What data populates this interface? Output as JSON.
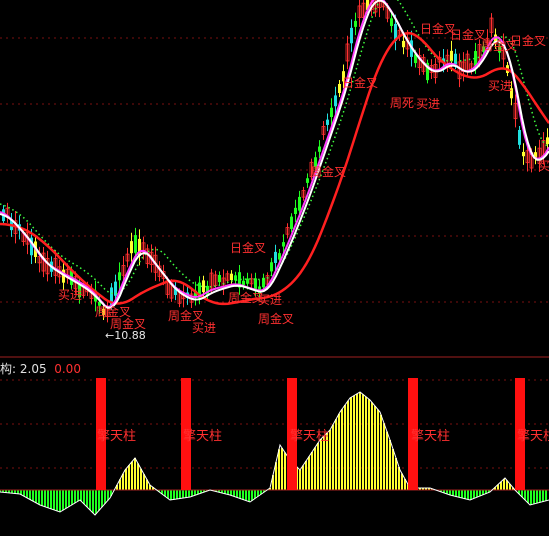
{
  "colors": {
    "background": "#000000",
    "price_up": "#ff3030",
    "price_down": "#20e0e0",
    "volume_up": "#ffff30",
    "volume_down": "#20ff20",
    "ma_white": "#ffffff",
    "ma_magenta": "#ff40ff",
    "ma_red": "#ff2020",
    "ma_dotted": "#40ff40",
    "pillar": "#ff1010",
    "divider": "#a02020"
  },
  "price_panel": {
    "low_marker": "10.88",
    "annotations": [
      "周金叉",
      "买进",
      "周金叉",
      "周金叉",
      "买进",
      "日金叉",
      "周金叉",
      "买进",
      "周金叉",
      "周金叉",
      "日金叉",
      "周死",
      "买进",
      "日金叉",
      "日金叉",
      "周金叉",
      "买进",
      "日金叉",
      "买"
    ]
  },
  "indicator_panel": {
    "label": "构:",
    "value_white": "2.05",
    "value_red": "0.00",
    "pillar_label": "擎天柱",
    "pillar_labels": [
      "擎天柱",
      "擎天柱",
      "擎天柱",
      "擎天柱",
      "擎天柱"
    ]
  }
}
